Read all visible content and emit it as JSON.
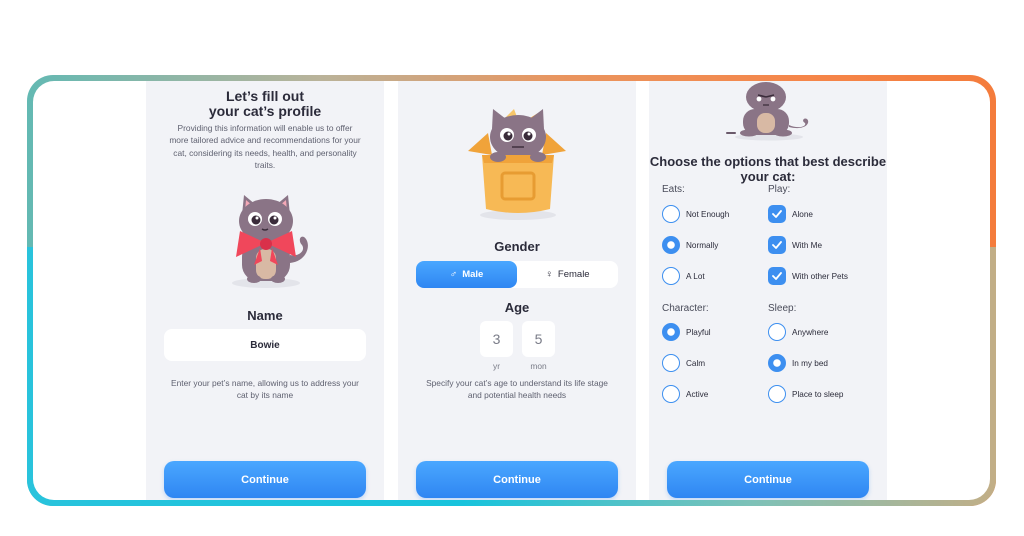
{
  "profile_screen": {
    "title_line1": "Let’s fill out",
    "title_line2": "your cat’s profile",
    "description": "Providing this information will enable us to offer more tailored advice and recommendations for your cat, considering its needs, health, and personality traits.",
    "name_label": "Name",
    "name_value": "Bowie",
    "name_hint": "Enter your pet’s name, allowing us to address your cat by its name",
    "continue_label": "Continue"
  },
  "gender_age_screen": {
    "gender_label": "Gender",
    "gender_options": [
      {
        "label": "Male",
        "icon": "male-icon",
        "selected": true
      },
      {
        "label": "Female",
        "icon": "female-icon",
        "selected": false
      }
    ],
    "age_label": "Age",
    "age_years": "3",
    "age_years_unit": "yr",
    "age_months": "5",
    "age_months_unit": "mon",
    "age_hint": "Specify your cat’s age to understand its life stage and potential health needs",
    "continue_label": "Continue"
  },
  "traits_screen": {
    "title": "Choose the options that best describe your cat:",
    "eats": {
      "label": "Eats:",
      "options": [
        {
          "label": "Not Enough",
          "selected": false
        },
        {
          "label": "Normally",
          "selected": true
        },
        {
          "label": "A Lot",
          "selected": false
        }
      ]
    },
    "play": {
      "label": "Play:",
      "options": [
        {
          "label": "Alone",
          "selected": true
        },
        {
          "label": "With Me",
          "selected": true
        },
        {
          "label": "With other Pets",
          "selected": true
        }
      ]
    },
    "character": {
      "label": "Character:",
      "options": [
        {
          "label": "Playful",
          "selected": true
        },
        {
          "label": "Calm",
          "selected": false
        },
        {
          "label": "Active",
          "selected": false
        }
      ]
    },
    "sleep": {
      "label": "Sleep:",
      "options": [
        {
          "label": "Anywhere",
          "selected": false
        },
        {
          "label": "In my bed",
          "selected": true
        },
        {
          "label": "Place to sleep",
          "selected": false
        }
      ]
    },
    "continue_label": "Continue"
  },
  "colors": {
    "accent": "#3d8ff0",
    "screen_bg": "#f2f3f7",
    "cat": "#8a7486",
    "bow": "#f0475b",
    "box": "#f7b955"
  }
}
